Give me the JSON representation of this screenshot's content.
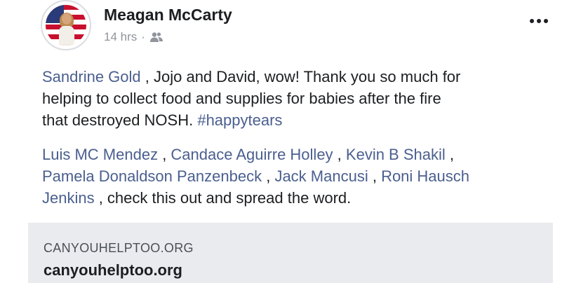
{
  "post": {
    "author": "Meagan McCarty",
    "timestamp": "14 hrs",
    "separator": "·",
    "audience_icon": "friends-icon",
    "more_icon": "more-options-icon",
    "paragraph1": {
      "line1": {
        "mention": "Sandrine Gold",
        "text": " , Jojo and David, wow! Thank you so much for"
      },
      "line2": "helping to collect food and supplies for babies after the fire",
      "line3": {
        "text": "that destroyed NOSH. ",
        "hashtag": "#happytears"
      }
    },
    "paragraph2": {
      "mentions": [
        "Luis MC Mendez",
        "Candace Aguirre Holley",
        "Kevin B Shakil",
        "Pamela Donaldson Panzenbeck",
        "Jack Mancusi",
        "Roni Hausch",
        "Jenkins"
      ],
      "separator": " , ",
      "trailing_comma": " ,",
      "closing_text": " , check this out and spread the word."
    }
  },
  "link_preview": {
    "domain": "CANYOUHELPTOO.ORG",
    "title": "canyouhelptoo.org"
  },
  "colors": {
    "mention": "#4a5f8f",
    "text": "#1c1e21",
    "meta": "#90949c",
    "card_background": "#e9ebee"
  }
}
